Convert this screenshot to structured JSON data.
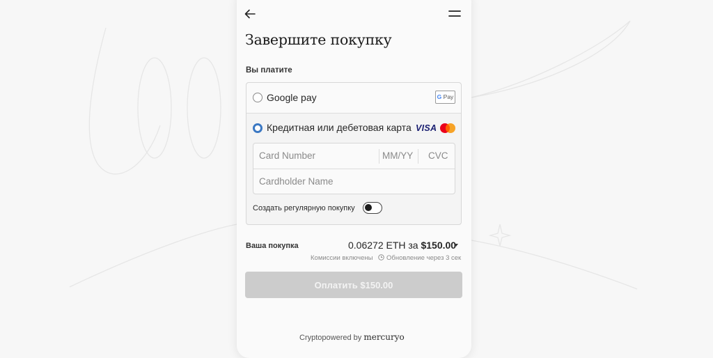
{
  "header": {
    "title": "Завершите покупку",
    "back_icon": "arrow-left-icon",
    "menu_icon": "hamburger-menu-icon"
  },
  "payment": {
    "section_label": "Вы платите",
    "options": [
      {
        "label": "Google pay",
        "selected": false,
        "badge": "G Pay"
      },
      {
        "label": "Кредитная или дебетовая карта",
        "selected": true,
        "brands": [
          "VISA",
          "Mastercard"
        ]
      }
    ],
    "card_number_placeholder": "Card Number",
    "expiry_placeholder": "MM/YY",
    "cvc_placeholder": "CVC",
    "cardholder_placeholder": "Cardholder Name",
    "recurring_label": "Создать регулярную покупку",
    "recurring_enabled": false
  },
  "purchase": {
    "label": "Ваша покупка",
    "crypto_amount": "0.06272 ETH за",
    "fiat_amount": "$150.00",
    "fees_note": "Комиссии включены",
    "refresh_note": "Обновление через 3 сек"
  },
  "pay_button": {
    "label": "Оплатить $150.00",
    "enabled": false
  },
  "footer": {
    "prefix": "Cryptopowered by",
    "brand": "mercuryo"
  },
  "colors": {
    "accent": "#3b78c3",
    "button_disabled": "#cccccc",
    "background": "#f7f7f7",
    "panel": "#fafafa"
  }
}
